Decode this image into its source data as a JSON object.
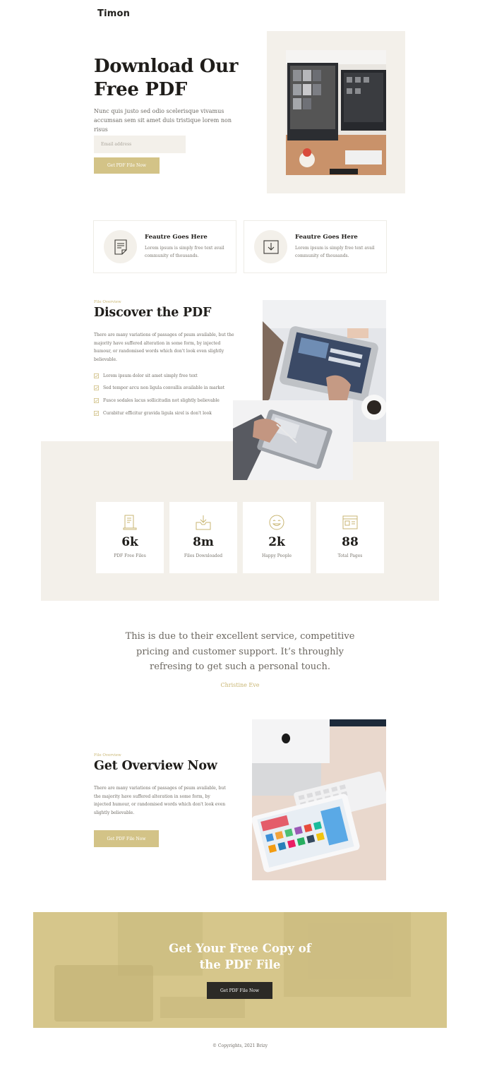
{
  "header": {
    "logo": "Timon"
  },
  "hero": {
    "title_line1": "Download Our",
    "title_line2": "Free PDF",
    "text": "Nunc quis justo sed odio scelerisque vivamus accumsan sem sit amet duis tristique lorem non risus",
    "email_placeholder": "Email address",
    "button": "Get PDF File Now"
  },
  "features": [
    {
      "title": "Feautre Goes Here",
      "text": "Lorem ipsum is simply free text avail community of thousands.",
      "icon": "document-note-icon"
    },
    {
      "title": "Feautre Goes Here",
      "text": "Lorem ipsum is simply free text avail community of thousands.",
      "icon": "download-box-icon"
    }
  ],
  "discover": {
    "kicker": "File Overview",
    "title": "Discover the PDF",
    "text": "There are many variations of passages of psum available, but the majority have suffered alteration in some form, by injected humour, or randomised words which don't look even slightly believable.",
    "checklist": [
      "Lorem ipsum dolor sit amet simply free text",
      "Sed tempor arcu non ligula convallis available in market",
      "Fusce sodales lacus sollicitudin not slightly believable",
      "Curabitur efficitur gravida ligula sirel is don't look"
    ]
  },
  "stats": [
    {
      "value": "6k",
      "label": "PDF Free Files",
      "icon": "file-icon"
    },
    {
      "value": "8m",
      "label": "Files Downloaded",
      "icon": "download-tray-icon"
    },
    {
      "value": "2k",
      "label": "Happy People",
      "icon": "smiley-icon"
    },
    {
      "value": "88",
      "label": "Total Pages",
      "icon": "page-layout-icon"
    }
  ],
  "testimonial": {
    "line1": "This is due to their excellent service, competitive",
    "line2": "pricing and customer support. It’s throughly",
    "line3": "refresing to get such a personal touch.",
    "author": "Christine Eve"
  },
  "overview": {
    "kicker": "File Overview",
    "title": "Get Overview Now",
    "text": "There are many variations of passages of psum available, but the majority have suffered alteration in some form, by injected humour, or randomised words which don't look even slightly believable.",
    "button": "Get PDF File Now"
  },
  "cta": {
    "title_line1": "Get Your Free Copy of",
    "title_line2": "the PDF File",
    "button": "Get PDF File Now"
  },
  "footer": {
    "copyright": "© Copyrights, 2021 Brizy"
  },
  "colors": {
    "accent": "#d3c387",
    "beige": "#f3f0ea",
    "dark": "#2c2a26"
  }
}
